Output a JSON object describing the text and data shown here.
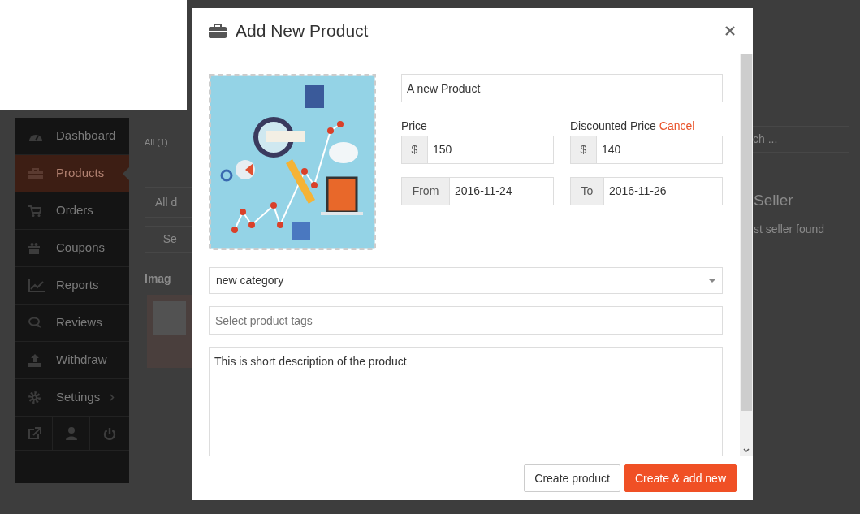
{
  "sidebar": {
    "items": [
      {
        "label": "Dashboard",
        "selected": false,
        "expandable": false
      },
      {
        "label": "Products",
        "selected": true,
        "expandable": false
      },
      {
        "label": "Orders",
        "selected": false,
        "expandable": false
      },
      {
        "label": "Coupons",
        "selected": false,
        "expandable": false
      },
      {
        "label": "Reports",
        "selected": false,
        "expandable": false
      },
      {
        "label": "Reviews",
        "selected": false,
        "expandable": false
      },
      {
        "label": "Withdraw",
        "selected": false,
        "expandable": false
      },
      {
        "label": "Settings",
        "selected": false,
        "expandable": true
      }
    ]
  },
  "background": {
    "filter_tab": "All (1)",
    "date_select": "All d",
    "category_select": "– Se",
    "column_header": "Imag",
    "search_placeholder": "ch ...",
    "widget_title": "Seller",
    "widget_text": "st seller found"
  },
  "modal": {
    "title": "Add New Product",
    "name": {
      "value": "A new Product"
    },
    "price": {
      "label": "Price",
      "currency": "$",
      "value": "150"
    },
    "discount": {
      "label": "Discounted Price",
      "cancel_link": "Cancel",
      "currency": "$",
      "value": "140"
    },
    "from": {
      "label": "From",
      "value": "2016-11-24"
    },
    "to": {
      "label": "To",
      "value": "2016-11-26"
    },
    "category": {
      "value": "new category"
    },
    "tags": {
      "placeholder": "Select product tags"
    },
    "description": {
      "value": "This is short description of the product"
    },
    "buttons": [
      {
        "label": "Create product",
        "kind": "secondary"
      },
      {
        "label": "Create & add new",
        "kind": "primary"
      }
    ]
  }
}
